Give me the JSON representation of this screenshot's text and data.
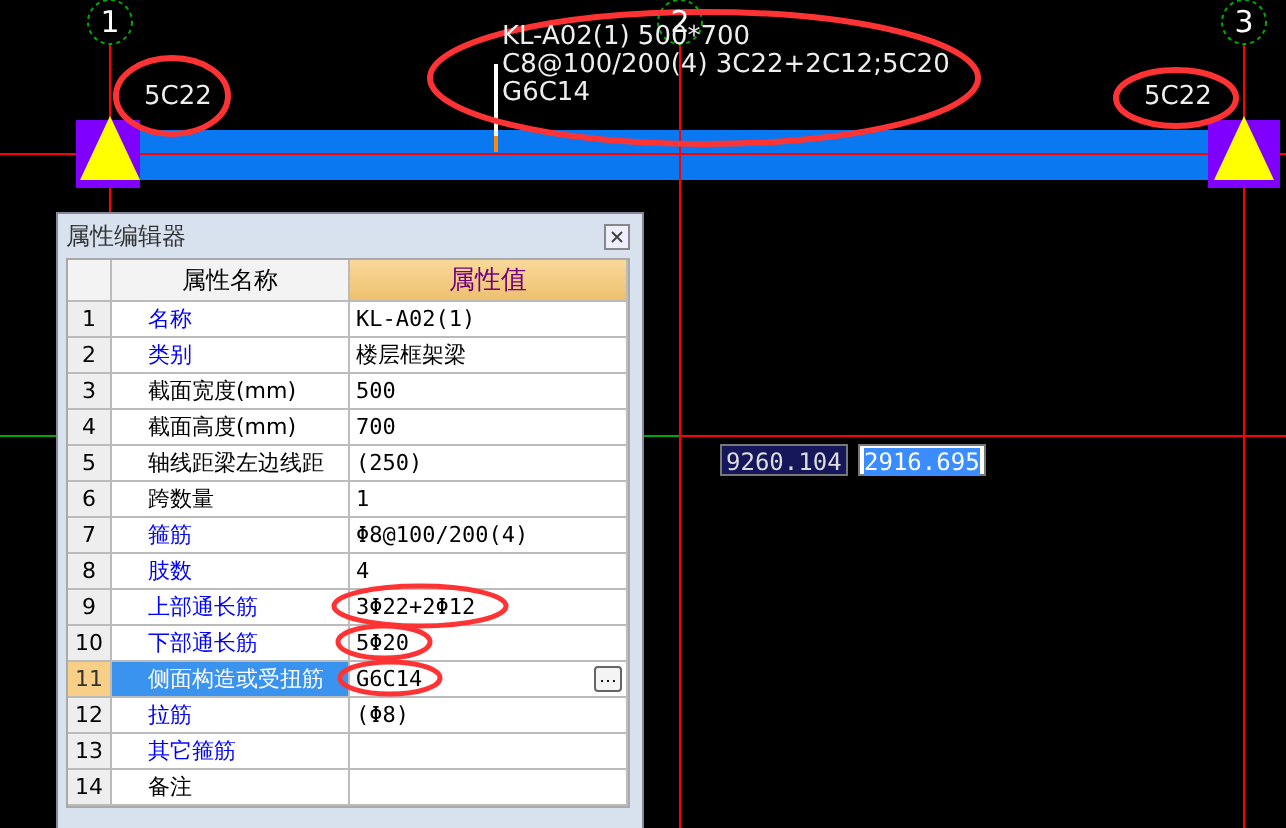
{
  "canvas": {
    "axes": [
      {
        "label": "1"
      },
      {
        "label": "2"
      },
      {
        "label": "3"
      }
    ],
    "beam_labels": {
      "left": "5C22",
      "right": "5C22",
      "lines": [
        "KL-A02(1) 500*700",
        "C8@100/200(4) 3C22+2C12;5C20",
        "G6C14"
      ]
    },
    "coordinate_inputs": [
      {
        "value": "9260.104",
        "selected": false
      },
      {
        "value": "2916.695",
        "selected": true
      }
    ]
  },
  "property_editor": {
    "title": "属性编辑器",
    "columns": [
      "属性名称",
      "属性值"
    ],
    "rows": [
      {
        "no": "1",
        "name": "名称",
        "value": "KL-A02(1)",
        "public": true,
        "selected": false
      },
      {
        "no": "2",
        "name": "类别",
        "value": "楼层框架梁",
        "public": true,
        "selected": false
      },
      {
        "no": "3",
        "name": "截面宽度(mm)",
        "value": "500",
        "public": false,
        "selected": false
      },
      {
        "no": "4",
        "name": "截面高度(mm)",
        "value": "700",
        "public": false,
        "selected": false
      },
      {
        "no": "5",
        "name": "轴线距梁左边线距",
        "value": "(250)",
        "public": false,
        "selected": false
      },
      {
        "no": "6",
        "name": "跨数量",
        "value": "1",
        "public": false,
        "selected": false
      },
      {
        "no": "7",
        "name": "箍筋",
        "value": "Φ8@100/200(4)",
        "public": true,
        "selected": false
      },
      {
        "no": "8",
        "name": "肢数",
        "value": "4",
        "public": true,
        "selected": false
      },
      {
        "no": "9",
        "name": "上部通长筋",
        "value": "3Φ22+2Φ12",
        "public": true,
        "selected": false
      },
      {
        "no": "10",
        "name": "下部通长筋",
        "value": "5Φ20",
        "public": true,
        "selected": false
      },
      {
        "no": "11",
        "name": "侧面构造或受扭筋",
        "value": "G6C14",
        "public": true,
        "selected": true,
        "action_button": "⋯"
      },
      {
        "no": "12",
        "name": "拉筋",
        "value": "(Φ8)",
        "public": true,
        "selected": false
      },
      {
        "no": "13",
        "name": "其它箍筋",
        "value": "",
        "public": true,
        "selected": false
      },
      {
        "no": "14",
        "name": "备注",
        "value": "",
        "public": false,
        "selected": false
      }
    ]
  }
}
